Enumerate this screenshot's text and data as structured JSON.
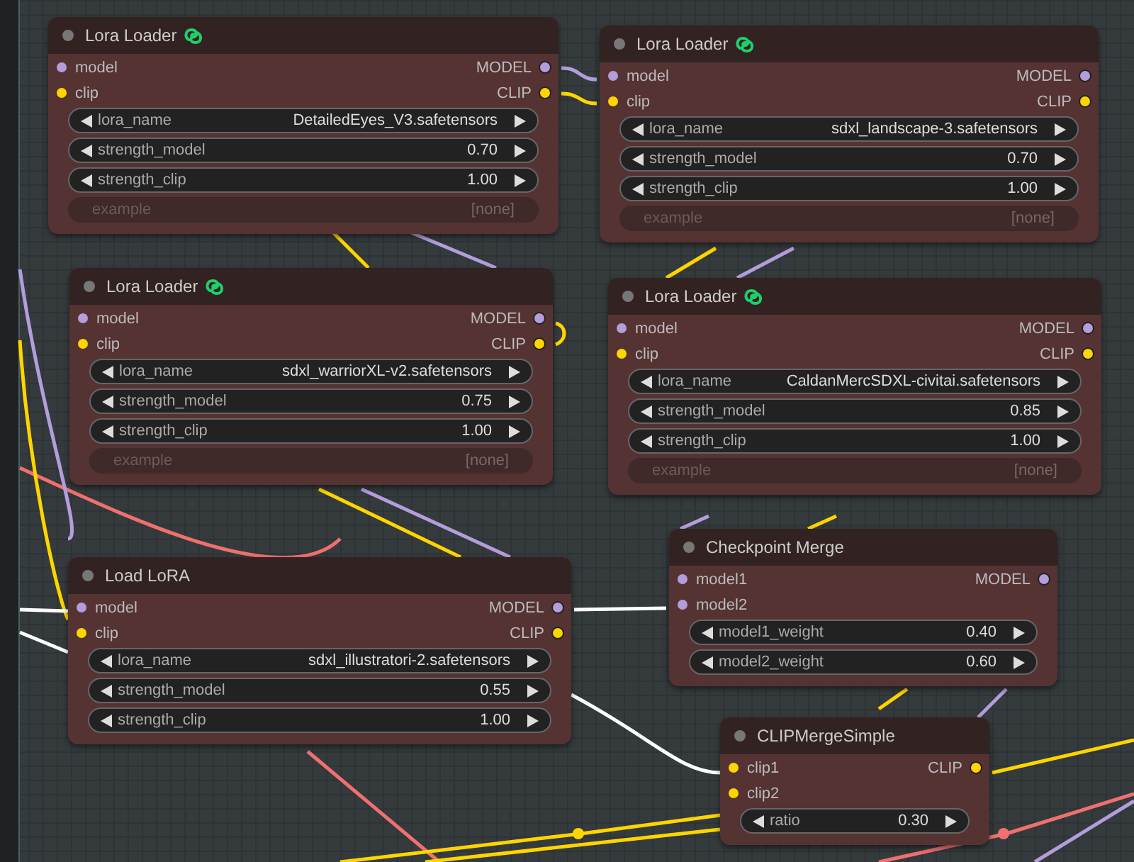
{
  "nodes": [
    {
      "title": "Lora Loader",
      "badge": true,
      "inputs": [
        {
          "name": "model",
          "kind": "model"
        },
        {
          "name": "clip",
          "kind": "clip"
        }
      ],
      "outputs": [
        {
          "name": "MODEL",
          "kind": "model"
        },
        {
          "name": "CLIP",
          "kind": "clip"
        }
      ],
      "widgets": [
        {
          "label": "lora_name",
          "value": "DetailedEyes_V3.safetensors",
          "disabled": false
        },
        {
          "label": "strength_model",
          "value": "0.70",
          "disabled": false
        },
        {
          "label": "strength_clip",
          "value": "1.00",
          "disabled": false
        },
        {
          "label": "example",
          "value": "[none]",
          "disabled": true
        }
      ]
    },
    {
      "title": "Lora Loader",
      "badge": true,
      "inputs": [
        {
          "name": "model",
          "kind": "model"
        },
        {
          "name": "clip",
          "kind": "clip"
        }
      ],
      "outputs": [
        {
          "name": "MODEL",
          "kind": "model"
        },
        {
          "name": "CLIP",
          "kind": "clip"
        }
      ],
      "widgets": [
        {
          "label": "lora_name",
          "value": "sdxl_landscape-3.safetensors",
          "disabled": false
        },
        {
          "label": "strength_model",
          "value": "0.70",
          "disabled": false
        },
        {
          "label": "strength_clip",
          "value": "1.00",
          "disabled": false
        },
        {
          "label": "example",
          "value": "[none]",
          "disabled": true
        }
      ]
    },
    {
      "title": "Lora Loader",
      "badge": true,
      "inputs": [
        {
          "name": "model",
          "kind": "model"
        },
        {
          "name": "clip",
          "kind": "clip"
        }
      ],
      "outputs": [
        {
          "name": "MODEL",
          "kind": "model"
        },
        {
          "name": "CLIP",
          "kind": "clip"
        }
      ],
      "widgets": [
        {
          "label": "lora_name",
          "value": "sdxl_warriorXL-v2.safetensors",
          "disabled": false
        },
        {
          "label": "strength_model",
          "value": "0.75",
          "disabled": false
        },
        {
          "label": "strength_clip",
          "value": "1.00",
          "disabled": false
        },
        {
          "label": "example",
          "value": "[none]",
          "disabled": true
        }
      ]
    },
    {
      "title": "Lora Loader",
      "badge": true,
      "inputs": [
        {
          "name": "model",
          "kind": "model"
        },
        {
          "name": "clip",
          "kind": "clip"
        }
      ],
      "outputs": [
        {
          "name": "MODEL",
          "kind": "model"
        },
        {
          "name": "CLIP",
          "kind": "clip"
        }
      ],
      "widgets": [
        {
          "label": "lora_name",
          "value": "CaldanMercSDXL-civitai.safetensors",
          "disabled": false
        },
        {
          "label": "strength_model",
          "value": "0.85",
          "disabled": false
        },
        {
          "label": "strength_clip",
          "value": "1.00",
          "disabled": false
        },
        {
          "label": "example",
          "value": "[none]",
          "disabled": true
        }
      ]
    },
    {
      "title": "Checkpoint Merge",
      "badge": false,
      "inputs": [
        {
          "name": "model1",
          "kind": "model"
        },
        {
          "name": "model2",
          "kind": "model"
        }
      ],
      "outputs": [
        {
          "name": "MODEL",
          "kind": "model"
        }
      ],
      "widgets": [
        {
          "label": "model1_weight",
          "value": "0.40",
          "disabled": false
        },
        {
          "label": "model2_weight",
          "value": "0.60",
          "disabled": false
        }
      ]
    },
    {
      "title": "Load LoRA",
      "badge": false,
      "inputs": [
        {
          "name": "model",
          "kind": "model"
        },
        {
          "name": "clip",
          "kind": "clip"
        }
      ],
      "outputs": [
        {
          "name": "MODEL",
          "kind": "model"
        },
        {
          "name": "CLIP",
          "kind": "clip"
        }
      ],
      "widgets": [
        {
          "label": "lora_name",
          "value": "sdxl_illustratori-2.safetensors",
          "disabled": false
        },
        {
          "label": "strength_model",
          "value": "0.55",
          "disabled": false
        },
        {
          "label": "strength_clip",
          "value": "1.00",
          "disabled": false
        }
      ]
    },
    {
      "title": "CLIPMergeSimple",
      "badge": false,
      "inputs": [
        {
          "name": "clip1",
          "kind": "clip"
        },
        {
          "name": "clip2",
          "kind": "clip"
        }
      ],
      "outputs": [
        {
          "name": "CLIP",
          "kind": "clip"
        }
      ],
      "widgets": [
        {
          "label": "ratio",
          "value": "0.30",
          "disabled": false
        }
      ]
    }
  ]
}
